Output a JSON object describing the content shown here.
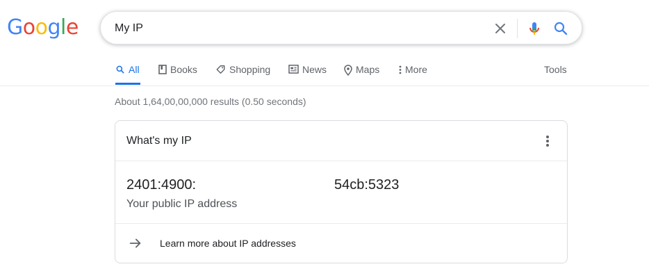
{
  "logo": {
    "letters": [
      "G",
      "o",
      "o",
      "g",
      "l",
      "e"
    ]
  },
  "search": {
    "query": "My IP"
  },
  "tabs": [
    {
      "label": "All",
      "icon": "search-icon"
    },
    {
      "label": "Books",
      "icon": "book-icon"
    },
    {
      "label": "Shopping",
      "icon": "tag-icon"
    },
    {
      "label": "News",
      "icon": "newspaper-icon"
    },
    {
      "label": "Maps",
      "icon": "map-pin-icon"
    },
    {
      "label": "More",
      "icon": "more-vert-icon"
    }
  ],
  "tools_label": "Tools",
  "result_stats": "About 1,64,00,00,000 results (0.50 seconds)",
  "card": {
    "title": "What's my IP",
    "ip_part_1": "2401:4900:",
    "ip_part_2": "54cb:5323",
    "caption": "Your public IP address",
    "learn_more": "Learn more about IP addresses"
  },
  "colors": {
    "accent": "#1a73e8",
    "text": "#202124",
    "muted": "#5f6368"
  }
}
